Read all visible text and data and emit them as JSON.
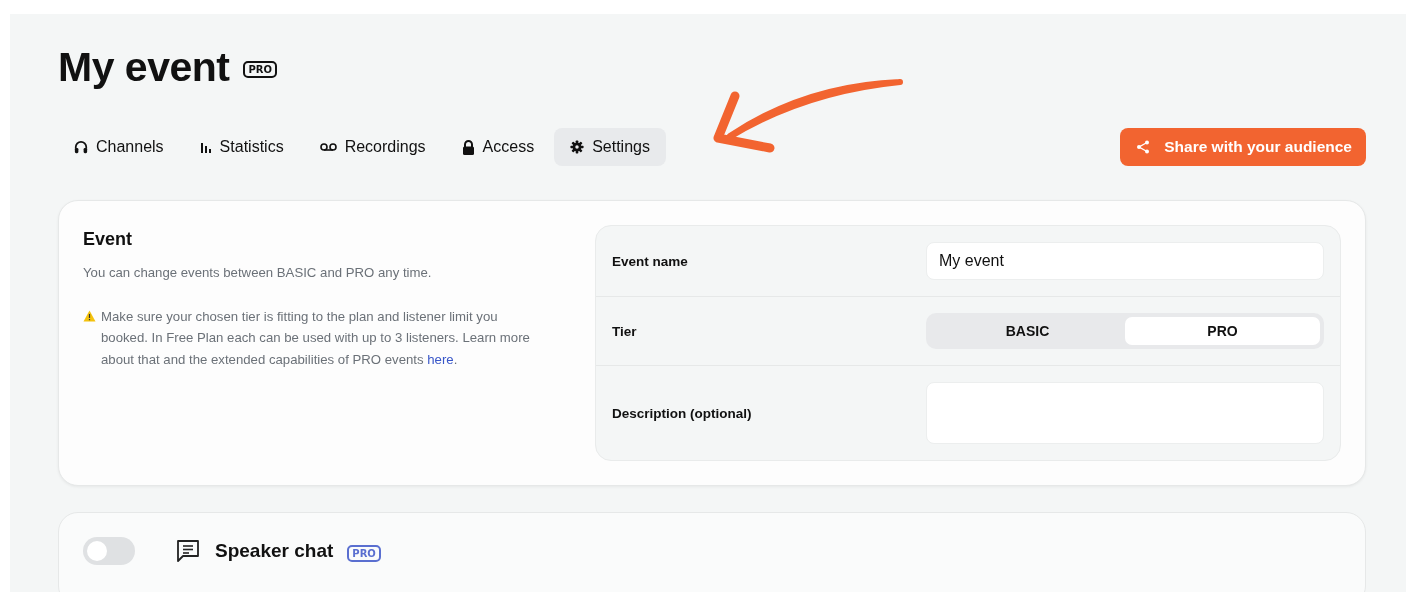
{
  "title": "My event",
  "title_badge": "PRO",
  "tabs": [
    {
      "label": "Channels",
      "kind": "headphones",
      "selected": false
    },
    {
      "label": "Statistics",
      "kind": "bars",
      "selected": false
    },
    {
      "label": "Recordings",
      "kind": "voicemail",
      "selected": false
    },
    {
      "label": "Access",
      "kind": "lock",
      "selected": false
    },
    {
      "label": "Settings",
      "kind": "gear",
      "selected": true
    }
  ],
  "share_button": "Share with your audience",
  "event_card": {
    "heading": "Event",
    "intro": "You can change events between BASIC and PRO any time.",
    "note": "Make sure your chosen tier is fitting to the plan and listener limit you booked. In Free Plan each can be used with up to 3 listeners. Learn more about that and the extended capabilities of PRO events",
    "note_link": "here",
    "note_end": ".",
    "fields": [
      {
        "label": "Event name",
        "kind": "text",
        "value": "My event"
      },
      {
        "label": "Tier",
        "kind": "segmented",
        "options": [
          {
            "label": "BASIC",
            "selected": false
          },
          {
            "label": "PRO",
            "selected": true
          }
        ]
      },
      {
        "label": "Description (optional)",
        "kind": "textarea"
      }
    ]
  },
  "speaker_chat": {
    "on": false,
    "title": "Speaker chat",
    "badge": "PRO"
  }
}
